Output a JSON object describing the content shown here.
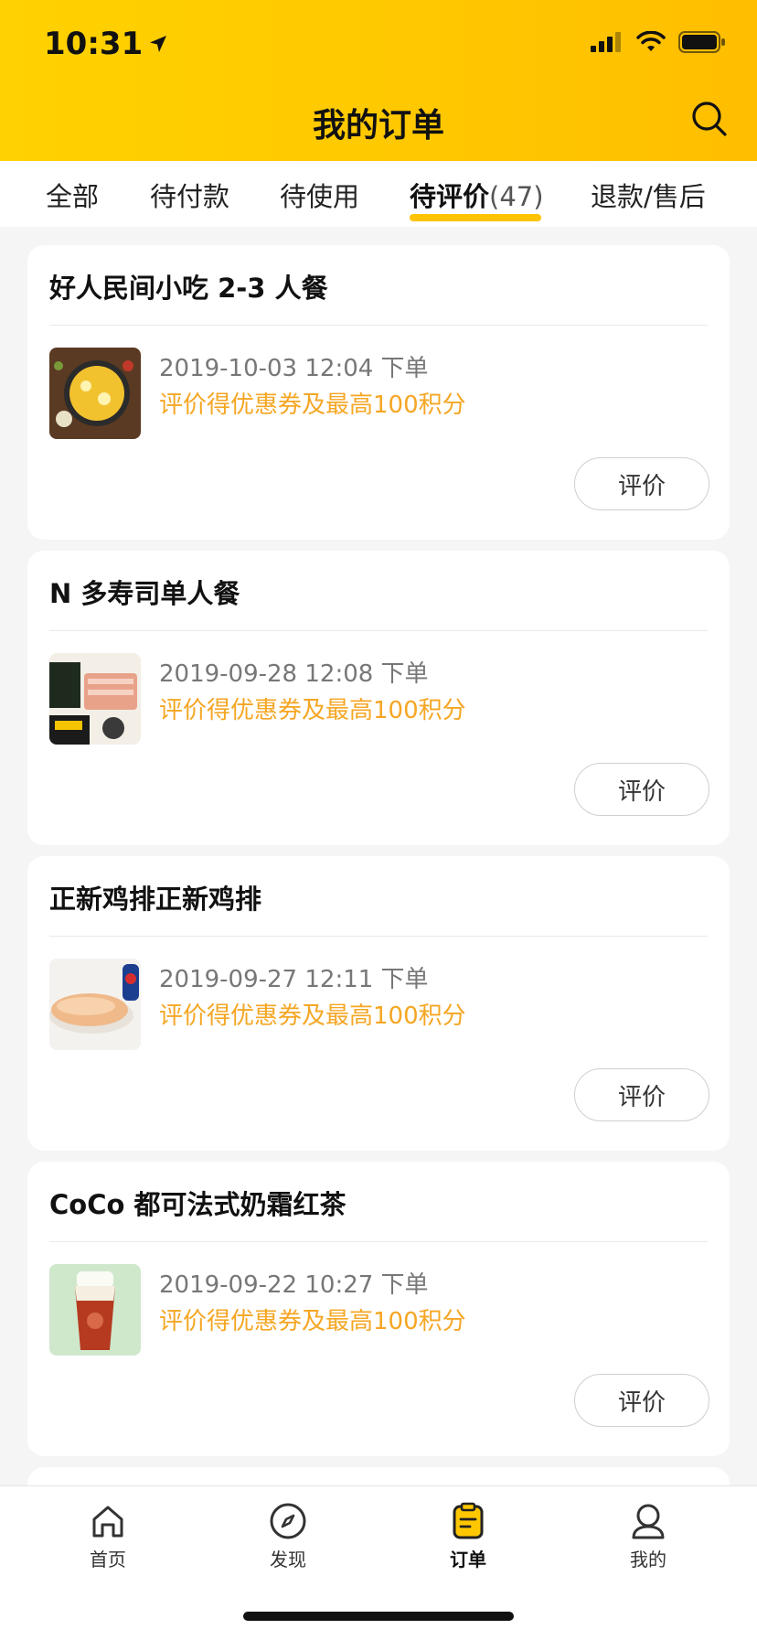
{
  "status_bar": {
    "time": "10:31"
  },
  "header": {
    "title": "我的订单",
    "search_icon": "search-icon"
  },
  "tabs": [
    {
      "label": "全部"
    },
    {
      "label": "待付款"
    },
    {
      "label": "待使用"
    },
    {
      "label": "待评价",
      "count": "(47)",
      "active": true
    },
    {
      "label": "退款/售后"
    }
  ],
  "orders": [
    {
      "title": "好人民间小吃 2-3 人餐",
      "time": "2019-10-03 12:04 下单",
      "promo": "评价得优惠券及最高100积分",
      "button": "评价"
    },
    {
      "title": "N 多寿司单人餐",
      "time": "2019-09-28 12:08 下单",
      "promo": "评价得优惠券及最高100积分",
      "button": "评价"
    },
    {
      "title": "正新鸡排正新鸡排",
      "time": "2019-09-27 12:11 下单",
      "promo": "评价得优惠券及最高100积分",
      "button": "评价"
    },
    {
      "title": "CoCo 都可法式奶霜红茶",
      "time": "2019-09-22 10:27 下单",
      "promo": "评价得优惠券及最高100积分",
      "button": "评价"
    }
  ],
  "tabbar": {
    "items": [
      {
        "label": "首页",
        "icon": "home-icon"
      },
      {
        "label": "发现",
        "icon": "compass-icon"
      },
      {
        "label": "订单",
        "icon": "order-icon",
        "active": true
      },
      {
        "label": "我的",
        "icon": "profile-icon"
      }
    ]
  },
  "colors": {
    "brand": "#FFC700",
    "promo": "#F5A623"
  }
}
